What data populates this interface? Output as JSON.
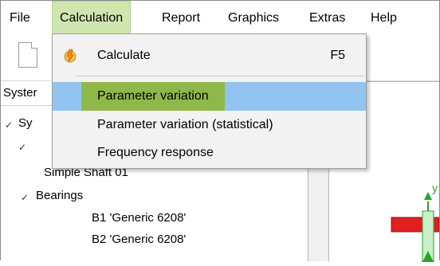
{
  "menubar": {
    "items": [
      "File",
      "Calculation",
      "Report",
      "Graphics",
      "Extras",
      "Help"
    ]
  },
  "panel": {
    "header": "Syster"
  },
  "tree": {
    "root": "Sy",
    "shaft": "Simple Shaft 01",
    "bearings_label": "Bearings",
    "bearings": [
      "B1 'Generic 6208'",
      "B2 'Generic 6208'"
    ]
  },
  "dropdown": {
    "calculate": "Calculate",
    "calculate_shortcut": "F5",
    "items": [
      "Parameter variation",
      "Parameter variation (statistical)",
      "Frequency response"
    ]
  },
  "graphics": {
    "axis_label": "y"
  },
  "colors": {
    "menu_active_bg": "#d0e6b0",
    "highlight_blue": "#91c4f0",
    "highlight_green": "#8fb84a",
    "shaft_red": "#e02020",
    "bearing_green": "#2ea02e"
  },
  "icons": [
    "document-icon",
    "calculate-icon",
    "chevron-down-icon",
    "axis-arrow-icon"
  ]
}
